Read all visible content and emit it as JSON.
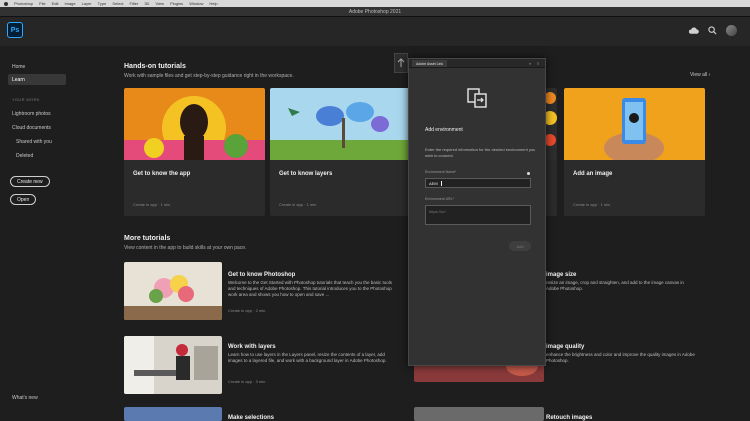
{
  "window": {
    "title": "Adobe Photoshop 2021"
  },
  "menubar": {
    "items": [
      "Photoshop",
      "File",
      "Edit",
      "Image",
      "Layer",
      "Type",
      "Select",
      "Filter",
      "3D",
      "View",
      "Plugins",
      "Window",
      "Help"
    ]
  },
  "header": {
    "logo": "Ps"
  },
  "sidebar": {
    "home": "Home",
    "learn": "Learn",
    "your_work_heading": "YOUR WORK",
    "lightroom": "Lightroom photos",
    "cloud_documents": "Cloud documents",
    "shared": "Shared with you",
    "deleted": "Deleted",
    "create_new": "Create new",
    "open": "Open",
    "whats_new": "What's new"
  },
  "handson": {
    "title": "Hands-on tutorials",
    "subtitle": "Work with sample files and get step-by-step guidance right in the workspace.",
    "view_all": "View all",
    "cards": [
      {
        "title": "Get to know the app",
        "meta": "Create in app · 1 min"
      },
      {
        "title": "Get to know layers",
        "meta": "Create in app · 1 min"
      },
      {
        "title": "",
        "meta": ""
      },
      {
        "title": "Add an image",
        "meta": "Create in app · 1 min"
      }
    ]
  },
  "more": {
    "title": "More tutorials",
    "subtitle": "View content in the app to build skills at your own pace.",
    "rows": [
      {
        "title": "Get to know Photoshop",
        "desc": "Welcome to the Get Started with Photoshop tutorials that teach you the basic tools and techniques of Adobe Photoshop. This tutorial introduces you to the Photoshop work area and shows you how to open and save ...",
        "meta": "Create in app · 2 min"
      },
      {
        "title": "Work with layers",
        "desc": "Learn how to use layers in the Layers panel, resize the contents of a layer, add images to a layered file, and work with a background layer in Adobe Photoshop.",
        "meta": "Create in app · 3 min"
      },
      {
        "title": "Make selections",
        "desc": "",
        "meta": ""
      }
    ],
    "right_rows": [
      {
        "title": "image size",
        "desc": "resize an image, crop and straighten, and add to the image canvas in Adobe Photoshop."
      },
      {
        "title": "image quality",
        "desc": "enhance the brightness and color and improve the quality images in Adobe Photoshop."
      },
      {
        "title": "Retouch images",
        "desc": ""
      }
    ]
  },
  "panel": {
    "tab": "Adobe Asset Link",
    "controls": [
      "«",
      "≡"
    ],
    "heading": "Add environment",
    "description": "Enter the required information for the desired environment you wish to connect.",
    "env_label": "Environment Name*",
    "env_value": "AEM",
    "url_label": "Environment URL*",
    "url_placeholder": "https://url",
    "button": "Add"
  }
}
